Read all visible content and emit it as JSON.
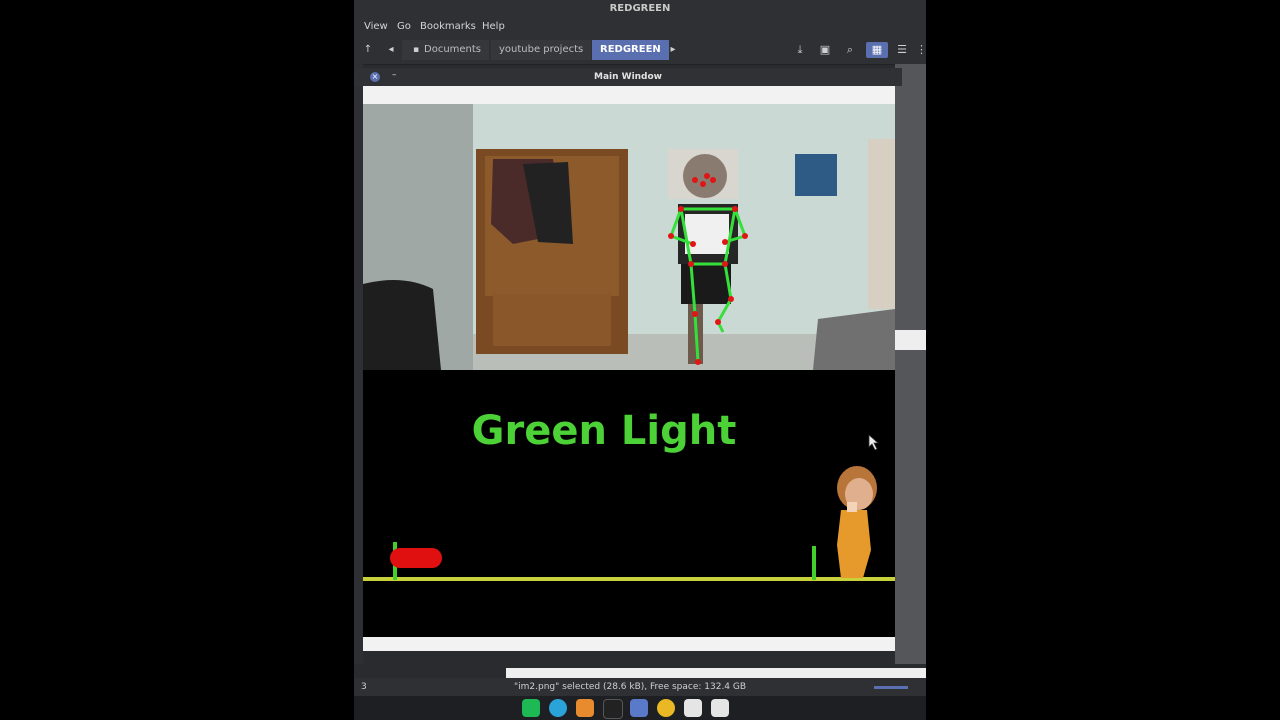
{
  "file_manager": {
    "title": "REDGREEN",
    "menu": [
      "View",
      "Go",
      "Bookmarks",
      "Help"
    ],
    "breadcrumbs": [
      "Documents",
      "youtube projects",
      "REDGREEN"
    ],
    "status_text": "\"im2.png\" selected (28.6 kB), Free space: 132.4 GB",
    "status_left": "3"
  },
  "window": {
    "title": "Main Window",
    "minimize_label": "–"
  },
  "game": {
    "status_text": "Green Light",
    "status_color": "#4cd137",
    "track_color": "#c8d23a",
    "player_color": "#e01010",
    "marker_color": "#44d02c"
  },
  "dock": {
    "icons": [
      "spotify-icon",
      "telegram-icon",
      "blender-icon",
      "terminal-icon",
      "files-icon",
      "chrome-icon",
      "settings-icon",
      "settings-icon"
    ]
  }
}
